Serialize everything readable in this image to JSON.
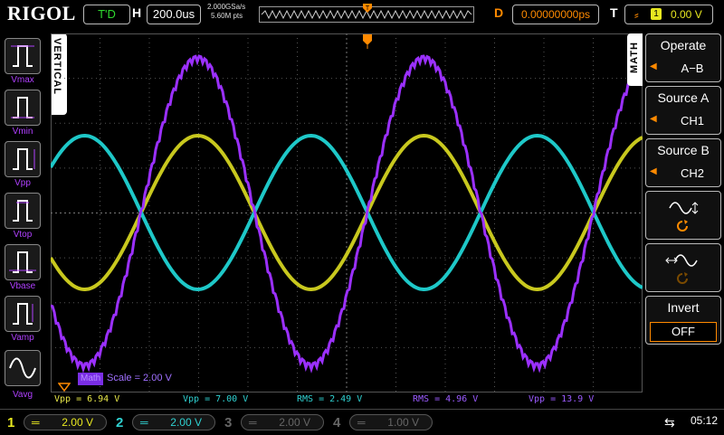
{
  "topbar": {
    "logo": "RIGOL",
    "status": "T'D",
    "horizontal_label": "H",
    "timebase": "200.0us",
    "sample_rate": "2.000GSa/s",
    "memory_depth": "5.60M pts",
    "delay_label": "D",
    "delay_value": "0.00000000ps",
    "trigger_label": "T",
    "trigger_source": "1",
    "trigger_level": "0.00 V"
  },
  "left_panel": {
    "tab_label": "VERTICAL",
    "items": [
      {
        "label": "Vmax"
      },
      {
        "label": "Vmin"
      },
      {
        "label": "Vpp"
      },
      {
        "label": "Vtop"
      },
      {
        "label": "Vbase"
      },
      {
        "label": "Vamp"
      },
      {
        "label": "Vavg"
      }
    ]
  },
  "right_panel": {
    "tab_label": "MATH",
    "operate_label": "Operate",
    "operate_value": "A−B",
    "source_a_label": "Source A",
    "source_a_value": "CH1",
    "source_b_label": "Source B",
    "source_b_value": "CH2",
    "invert_label": "Invert",
    "invert_value": "OFF"
  },
  "waveform": {
    "math_label": "Math",
    "math_scale": "Scale = 2.00 V",
    "colors": {
      "ch1": "#c8c81e",
      "ch2": "#1ec8c8",
      "math": "#9b30ff",
      "grid": "#555555"
    }
  },
  "measurements": [
    {
      "text": "Vpp = 6.94 V",
      "color": "#e8e84a"
    },
    {
      "text": "Vpp = 7.00 V",
      "color": "#2fd0d0"
    },
    {
      "text": "RMS = 2.49 V",
      "color": "#2fd0d0"
    },
    {
      "text": "RMS = 4.96 V",
      "color": "#9b5bff"
    },
    {
      "text": "Vpp = 13.9 V",
      "color": "#9b5bff"
    }
  ],
  "channels": [
    {
      "num": "1",
      "coupling": "═",
      "scale": "2.00 V",
      "color": "#e8e820"
    },
    {
      "num": "2",
      "coupling": "═",
      "scale": "2.00 V",
      "color": "#2fd0d0"
    },
    {
      "num": "3",
      "coupling": "═",
      "scale": "2.00 V",
      "color": "#666666"
    },
    {
      "num": "4",
      "coupling": "═",
      "scale": "1.00 V",
      "color": "#666666"
    }
  ],
  "clock": "05:12"
}
